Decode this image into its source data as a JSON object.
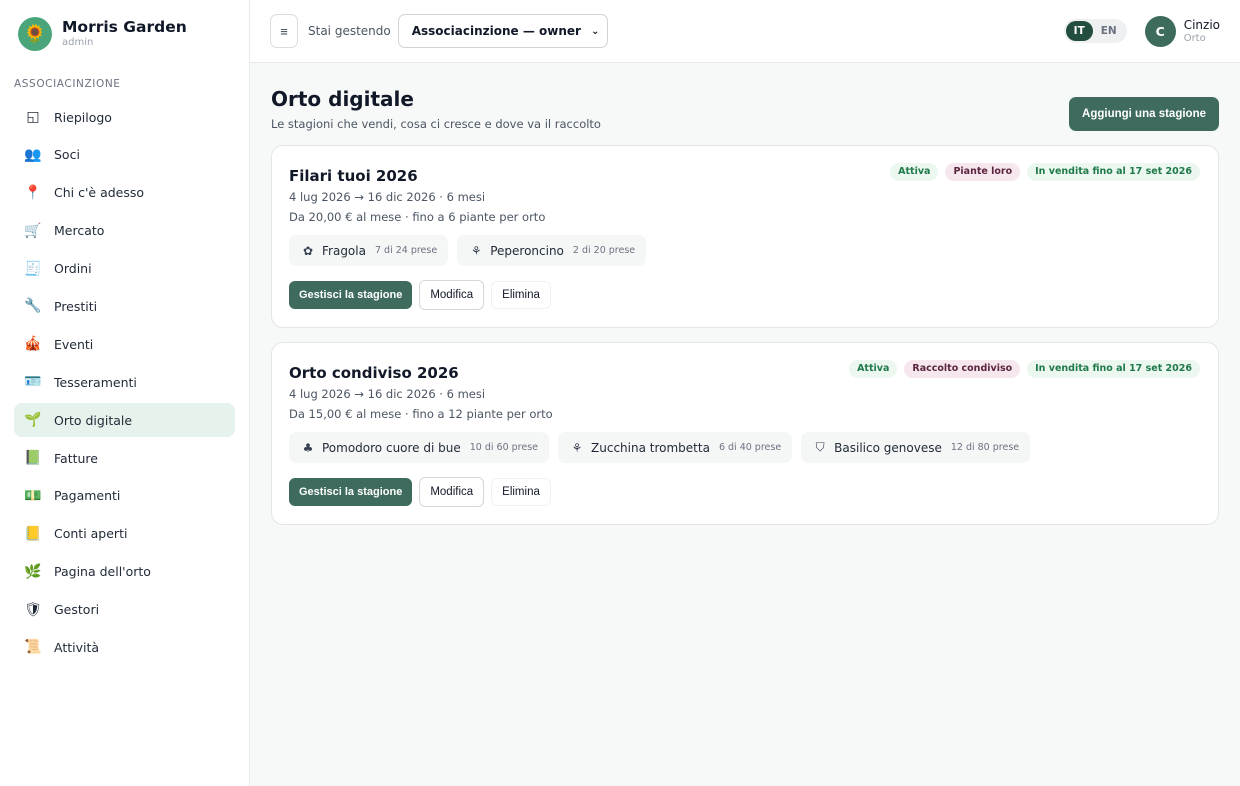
{
  "brand": {
    "name": "Morris Garden",
    "role": "admin",
    "logo_icon": "sunflower-icon"
  },
  "sidebar": {
    "section_label": "ASSOCIACINZIONE",
    "items": [
      {
        "label": "Riepilogo",
        "icon": "◱",
        "active": false
      },
      {
        "label": "Soci",
        "icon": "👥",
        "active": false
      },
      {
        "label": "Chi c'è adesso",
        "icon": "📍",
        "active": false
      },
      {
        "label": "Mercato",
        "icon": "🛒",
        "active": false
      },
      {
        "label": "Ordini",
        "icon": "🧾",
        "active": false
      },
      {
        "label": "Prestiti",
        "icon": "🔧",
        "active": false
      },
      {
        "label": "Eventi",
        "icon": "🎪",
        "active": false
      },
      {
        "label": "Tesseramenti",
        "icon": "🪪",
        "active": false
      },
      {
        "label": "Orto digitale",
        "icon": "🌱",
        "active": true
      },
      {
        "label": "Fatture",
        "icon": "📗",
        "active": false
      },
      {
        "label": "Pagamenti",
        "icon": "💵",
        "active": false
      },
      {
        "label": "Conti aperti",
        "icon": "📒",
        "active": false
      },
      {
        "label": "Pagina dell'orto",
        "icon": "🌿",
        "active": false
      },
      {
        "label": "Gestori",
        "icon": "🛡",
        "active": false
      },
      {
        "label": "Attività",
        "icon": "📜",
        "active": false
      }
    ]
  },
  "topbar": {
    "menu_icon": "≡",
    "managing_label": "Stai gestendo",
    "select_value": "Associacinzione — owner",
    "lang": {
      "it": "IT",
      "en": "EN",
      "active": "IT"
    },
    "user": {
      "initial": "C",
      "name": "Cinzio",
      "role": "Orto"
    }
  },
  "page": {
    "title": "Orto digitale",
    "subtitle": "Le stagioni che vendi, cosa ci cresce e dove va il raccolto",
    "add_button": "Aggiungi una stagione"
  },
  "seasons": [
    {
      "title": "Filari tuoi 2026",
      "dates": "4 lug 2026 → 16 dic 2026 · 6 mesi",
      "price": "Da 20,00 € al mese · fino a 6 piante per orto",
      "badges": [
        {
          "label": "Attiva",
          "style": "green"
        },
        {
          "label": "Piante loro",
          "style": "purple"
        },
        {
          "label": "In vendita fino al 17 set 2026",
          "style": "green"
        }
      ],
      "crops": [
        {
          "icon": "✿",
          "icon_name": "strawberry-icon",
          "name": "Fragola",
          "slots": "7 di 24 prese"
        },
        {
          "icon": "⚘",
          "icon_name": "sprout-icon",
          "name": "Peperoncino",
          "slots": "2 di 20 prese"
        }
      ],
      "actions": {
        "manage": "Gestisci la stagione",
        "edit": "Modifica",
        "delete": "Elimina"
      }
    },
    {
      "title": "Orto condiviso 2026",
      "dates": "4 lug 2026 → 16 dic 2026 · 6 mesi",
      "price": "Da 15,00 € al mese · fino a 12 piante per orto",
      "badges": [
        {
          "label": "Attiva",
          "style": "green"
        },
        {
          "label": "Raccolto condiviso",
          "style": "purple"
        },
        {
          "label": "In vendita fino al 17 set 2026",
          "style": "green"
        }
      ],
      "crops": [
        {
          "icon": "♣",
          "icon_name": "tomato-icon",
          "name": "Pomodoro cuore di bue",
          "slots": "10 di 60 prese"
        },
        {
          "icon": "⚘",
          "icon_name": "sprout-icon",
          "name": "Zucchina trombetta",
          "slots": "6 di 40 prese"
        },
        {
          "icon": "⛉",
          "icon_name": "basket-icon",
          "name": "Basilico genovese",
          "slots": "12 di 80 prese"
        }
      ],
      "actions": {
        "manage": "Gestisci la stagione",
        "edit": "Modifica",
        "delete": "Elimina"
      }
    }
  ]
}
